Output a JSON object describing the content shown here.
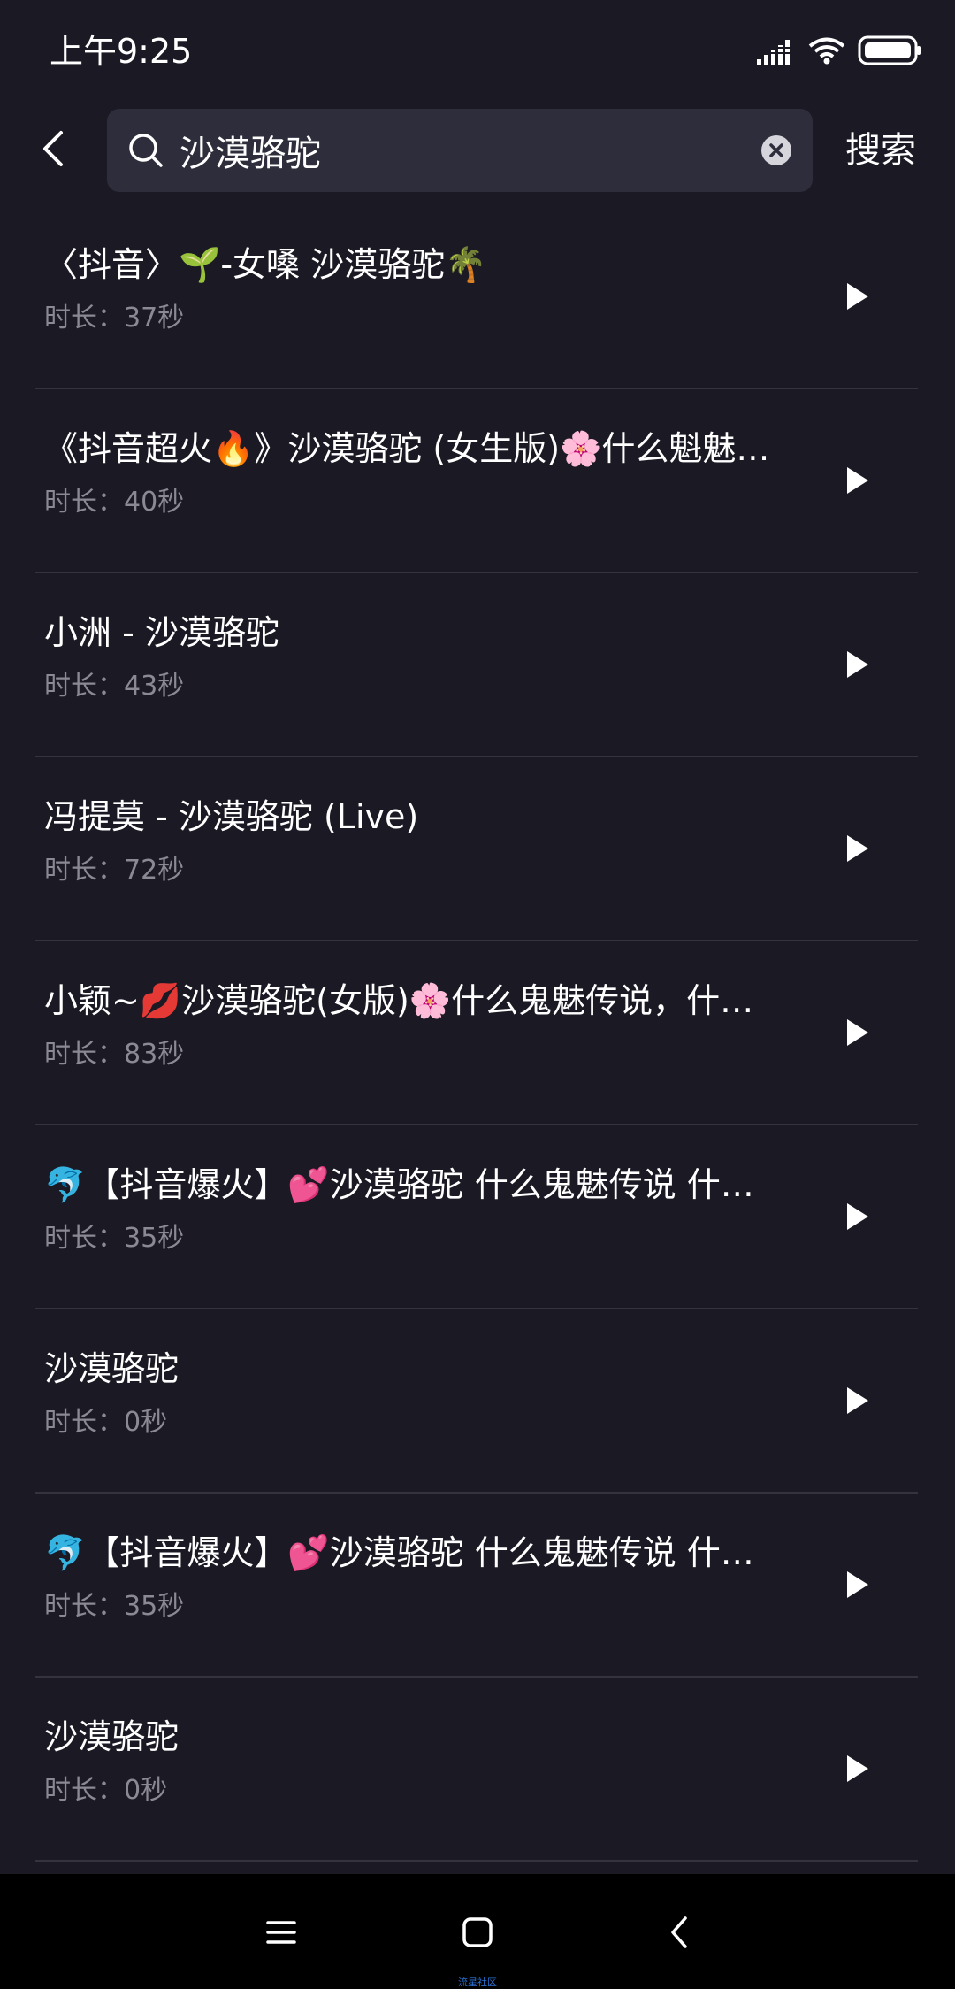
{
  "status_bar": {
    "time": "上午9:25",
    "icons": [
      "signal-icon",
      "wifi-icon",
      "battery-icon"
    ]
  },
  "header": {
    "back_icon": "chevron-left-icon",
    "search": {
      "value": "沙漠骆驼",
      "icon": "search-icon",
      "clear_icon": "clear-icon"
    },
    "search_button_label": "搜索"
  },
  "results": [
    {
      "title": "〈抖音〉🌱-女嗓   沙漠骆驼🌴",
      "duration": "时长：37秒"
    },
    {
      "title": "《抖音超火🔥》沙漠骆驼 (女生版)🌸什么魁魅传说，什么魂魄",
      "duration": "时长：40秒"
    },
    {
      "title": "小洲 - 沙漠骆驼",
      "duration": "时长：43秒"
    },
    {
      "title": "冯提莫 - 沙漠骆驼 (Live)",
      "duration": "时长：72秒"
    },
    {
      "title": "小颖~💋沙漠骆驼(女版)🌸什么鬼魅传说，什么魑魅魍魉",
      "duration": "时长：83秒"
    },
    {
      "title": "🐬【抖音爆火】💕沙漠骆驼  什么鬼魅传说  什么魑魅魍魉",
      "duration": "时长：35秒"
    },
    {
      "title": "沙漠骆驼",
      "duration": "时长：0秒"
    },
    {
      "title": "🐬【抖音爆火】💕沙漠骆驼  什么鬼魅传说  什么魑魅魍魉",
      "duration": "时长：35秒"
    },
    {
      "title": "沙漠骆驼",
      "duration": "时长：0秒"
    }
  ],
  "nav_bar": {
    "icons": [
      "menu-icon",
      "home-icon",
      "back-icon"
    ],
    "watermark": "流星社区"
  },
  "colors": {
    "background": "#1b1a24",
    "search_box": "#2e2d3b",
    "secondary_text": "#8b8a94",
    "divider": "#34333f"
  }
}
